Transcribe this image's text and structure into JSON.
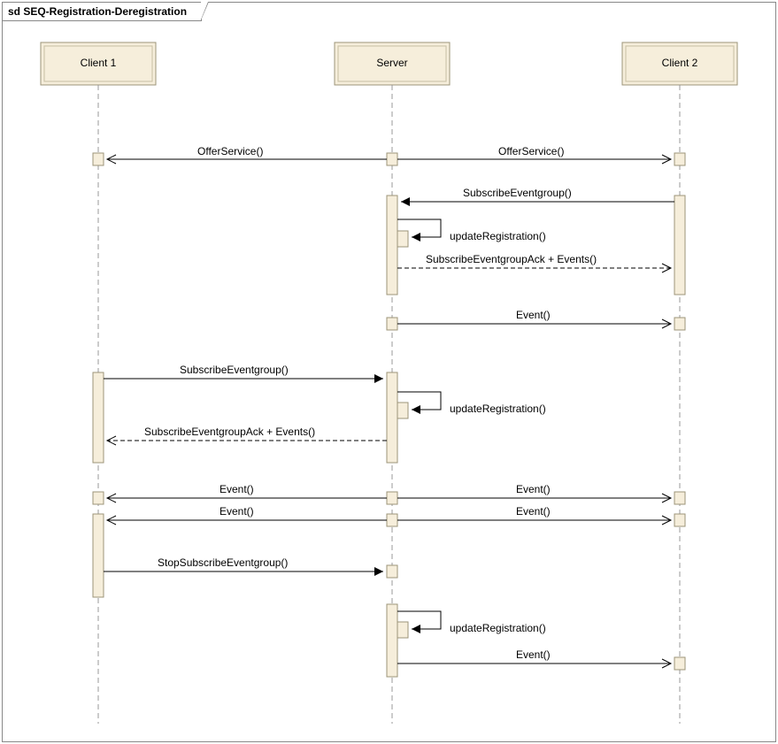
{
  "frame": {
    "title": "sd SEQ-Registration-Deregistration"
  },
  "lifelines": {
    "client1": "Client 1",
    "server": "Server",
    "client2": "Client 2"
  },
  "messages": {
    "offer_left": "OfferService()",
    "offer_right": "OfferService()",
    "sub_from_c2": "SubscribeEventgroup()",
    "update_reg_1": "updateRegistration()",
    "sub_ack_to_c2": "SubscribeEventgroupAck + Events()",
    "event_to_c2_1": "Event()",
    "sub_from_c1": "SubscribeEventgroup()",
    "update_reg_2": "updateRegistration()",
    "sub_ack_to_c1": "SubscribeEventgroupAck + Events()",
    "event_to_c1_a": "Event()",
    "event_to_c2_a": "Event()",
    "event_to_c1_b": "Event()",
    "event_to_c2_b": "Event()",
    "stop_sub_c1": "StopSubscribeEventgroup()",
    "update_reg_3": "updateRegistration()",
    "event_to_c2_final": "Event()"
  }
}
